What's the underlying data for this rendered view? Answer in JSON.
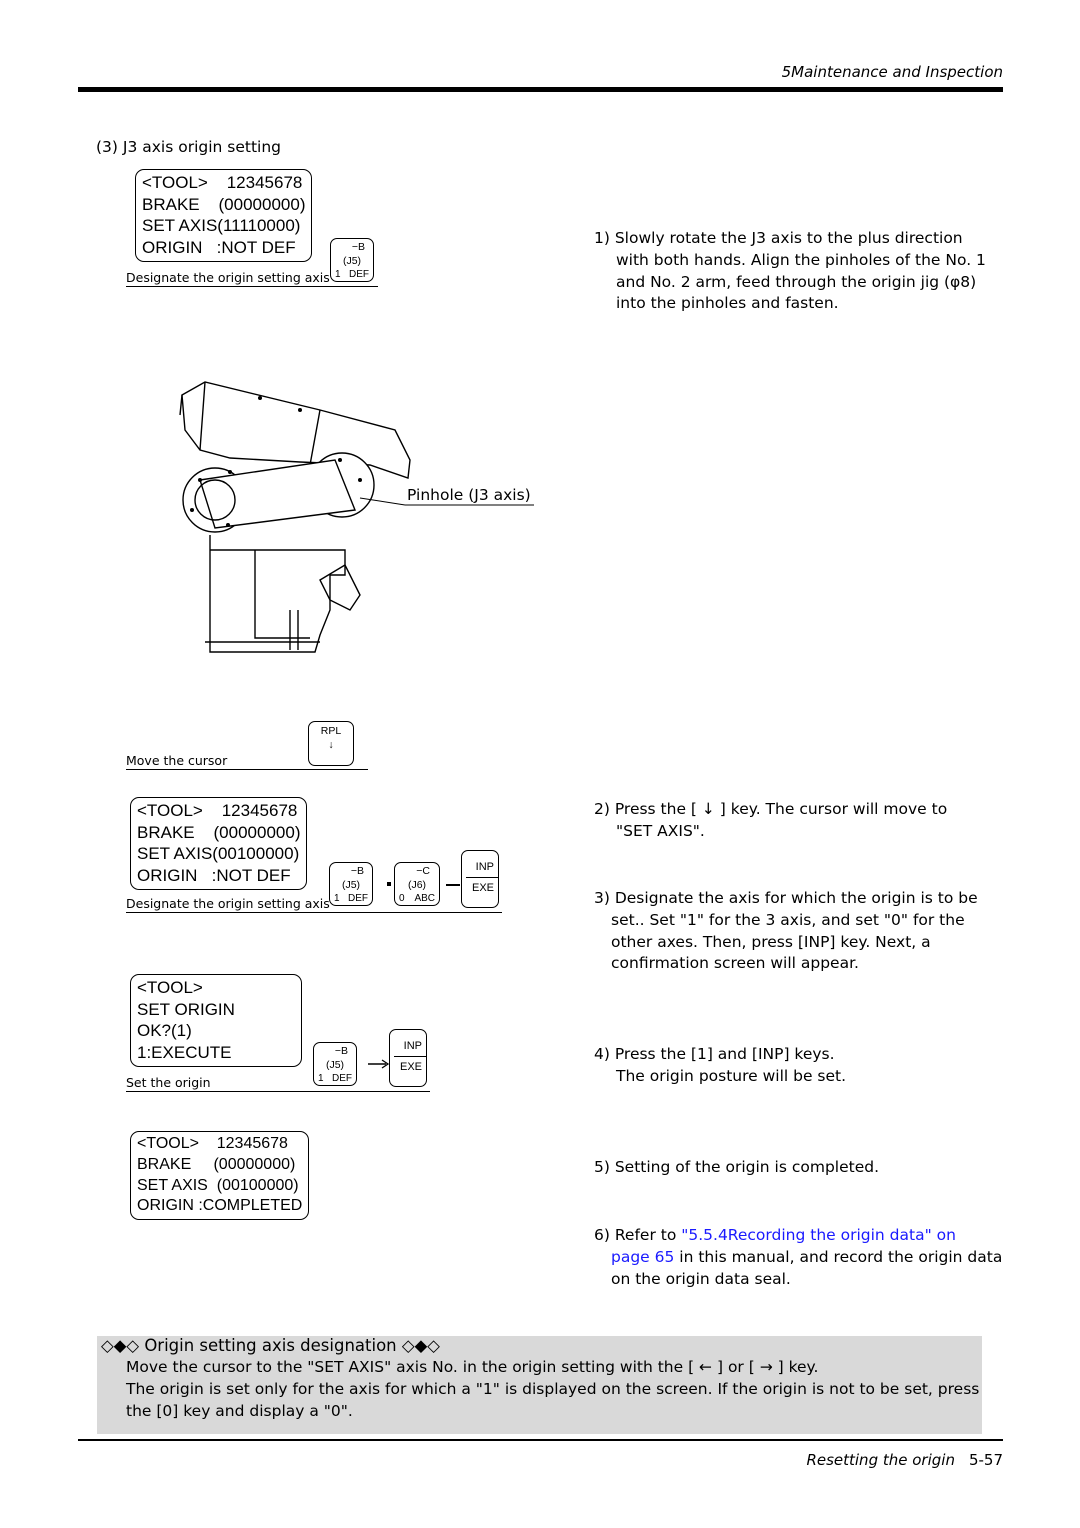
{
  "header": {
    "title": "5Maintenance and Inspection"
  },
  "section": {
    "title": "(3) J3 axis origin setting"
  },
  "screens": [
    {
      "lines": [
        "<TOOL>    12345678",
        "BRAKE    (00000000)",
        "SET AXIS(11110000)",
        "ORIGIN   :NOT DEF"
      ]
    },
    {
      "lines": [
        "<TOOL>    12345678",
        "BRAKE    (00000000)",
        "SET AXIS(00100000)",
        "ORIGIN   :NOT DEF"
      ]
    },
    {
      "lines": [
        "<TOOL>",
        "SET ORIGIN",
        "OK?(1)",
        "1:EXECUTE"
      ]
    },
    {
      "lines": [
        "<TOOL>    12345678",
        "BRAKE     (00000000)",
        "SET AXIS  (00100000)",
        "ORIGIN :COMPLETED"
      ]
    }
  ],
  "keys": {
    "j5": {
      "top": "−B",
      "mid": "(J5)",
      "left": "1",
      "right": "DEF"
    },
    "j6": {
      "top": "−C",
      "mid": "(J6)",
      "left": "0",
      "right": "ABC"
    },
    "rpl": {
      "top": "RPL",
      "mid": "↓"
    },
    "inp": {
      "top": "INP",
      "bottom": "EXE"
    }
  },
  "captions": {
    "designate": "Designate the origin setting axis",
    "move": "Move the cursor",
    "set": "Set the origin",
    "pinhole": "Pinhole (J3 axis)"
  },
  "steps": {
    "s1": [
      "1) Slowly rotate the J3 axis to the plus direction",
      "with both hands. Align the pinholes of the No. 1",
      "and No. 2 arm, feed through the origin jig (φ8)",
      "into the pinholes and fasten."
    ],
    "s2": [
      "2) Press the [ ↓ ] key. The cursor will move to",
      "\"SET AXIS\"."
    ],
    "s3": [
      "3) Designate the axis for which the origin is to be",
      "set.. Set \"1\" for the 3 axis, and set \"0\" for the",
      "other axes. Then, press [INP] key. Next, a",
      "confirmation screen will appear."
    ],
    "s4": [
      "4) Press the [1] and [INP] keys.",
      "The origin posture will be set."
    ],
    "s5": "5) Setting of the origin is completed.",
    "s6": {
      "pre": "6) Refer to ",
      "link1": "\"5.5.4Recording the origin data\" on",
      "link2": "page 65",
      "post": " in this manual, and record the origin data",
      "line3": "on the origin data seal."
    }
  },
  "note": {
    "title": "◇◆◇ Origin setting axis designation ◇◆◇",
    "lines": [
      "Move the cursor to the \"SET AXIS\" axis No. in the origin setting with the [ ← ] or [ → ] key.",
      "The origin is set only for the axis for which a \"1\" is displayed on the screen. If the origin is not to be set, press",
      "the [0] key and display a \"0\"."
    ]
  },
  "footer": {
    "section": "Resetting the origin",
    "page": "5-57"
  },
  "colors": {
    "link": "#1a1aff",
    "note_bg": "#d9d9d9"
  }
}
